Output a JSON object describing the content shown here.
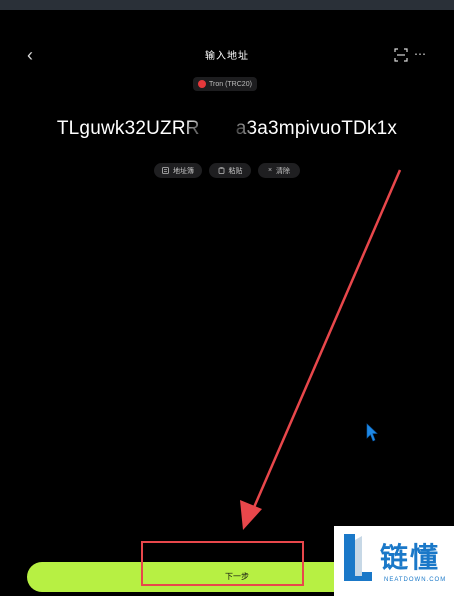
{
  "header": {
    "back_glyph": "‹",
    "title": "输入地址",
    "more_glyph": "⋯",
    "icons": [
      "back-icon",
      "scan-icon",
      "more-icon"
    ]
  },
  "network": {
    "label": "Tron (TRC20)",
    "icon": "tron-icon",
    "accent": "#e5383b"
  },
  "address": {
    "value": "TLguwk32UZRR         a3a3mpivuoTDk1x"
  },
  "actions": {
    "address_book": "地址簿",
    "paste": "粘贴",
    "clear": "清除",
    "clear_glyph": "×"
  },
  "footer": {
    "next_label": "下一步",
    "button_color": "#b7f043"
  },
  "annotation": {
    "box_color": "#e8474b"
  },
  "watermark": {
    "text": "链懂",
    "subtext": "NEATDOWN.COM"
  }
}
